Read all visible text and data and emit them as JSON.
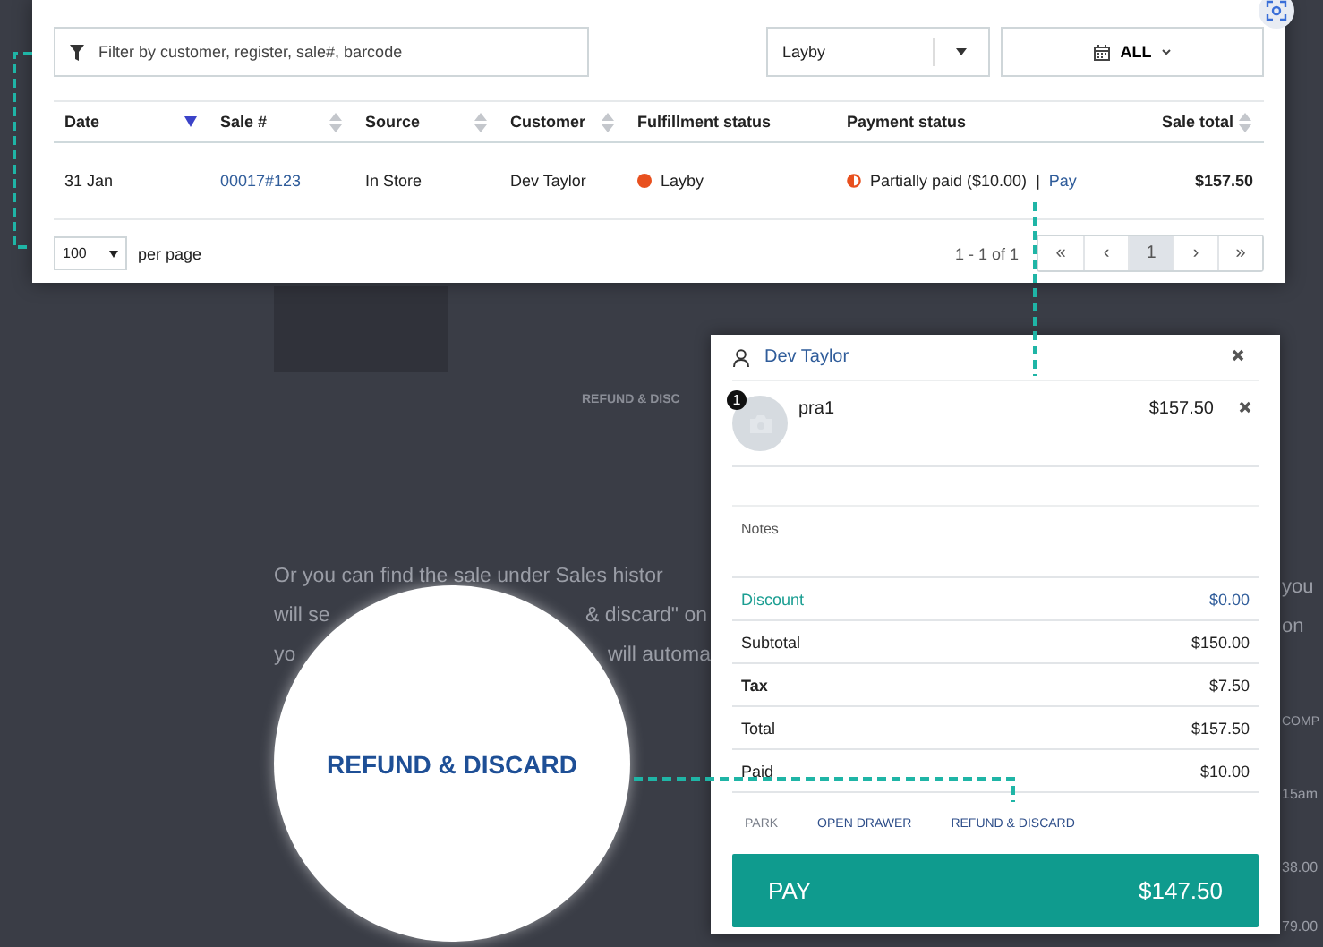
{
  "article": {
    "faded_button": "REFUND & DISC",
    "lines": [
      [
        "Or you can find the sale under Sales histor"
      ],
      [
        "will se",
        "& discard\" on"
      ],
      [
        "yo",
        "will automa"
      ]
    ],
    "edge_texts": [
      "you",
      "on",
      "COMP",
      "15am",
      "38.00",
      "79.00"
    ]
  },
  "filter": {
    "placeholder": "Filter by customer, register, sale#, barcode"
  },
  "status_select": {
    "value": "Layby"
  },
  "date_filter": {
    "label": "ALL"
  },
  "table": {
    "columns": [
      {
        "label": "Date",
        "sorted": true
      },
      {
        "label": "Sale #",
        "sorted": false
      },
      {
        "label": "Source",
        "sorted": false
      },
      {
        "label": "Customer",
        "sorted": false
      },
      {
        "label": "Fulfillment status"
      },
      {
        "label": "Payment status"
      },
      {
        "label": "Sale total",
        "sorted": false
      }
    ],
    "rows": [
      {
        "date": "31 Jan",
        "sale": "00017#123",
        "source": "In Store",
        "customer": "Dev Taylor",
        "fulfillment": {
          "label": "Layby",
          "color": "#e8501e"
        },
        "payment": {
          "label": "Partially paid ($10.00)",
          "separator": "|",
          "link": "Pay"
        },
        "total": "$157.50"
      }
    ]
  },
  "pagination": {
    "page_size": "100",
    "per_page_label": "per page",
    "range": "1 - 1 of 1",
    "buttons": [
      {
        "label": "«",
        "selected": false
      },
      {
        "label": "‹",
        "selected": false
      },
      {
        "label": "1",
        "selected": true
      },
      {
        "label": "›",
        "selected": false
      },
      {
        "label": "»",
        "selected": false
      }
    ]
  },
  "cart": {
    "customer": "Dev Taylor",
    "items": [
      {
        "qty": "1",
        "name": "pra1",
        "price": "$157.50"
      }
    ],
    "notes_label": "Notes",
    "totals": [
      {
        "label": "Discount",
        "value": "$0.00",
        "kind": "link"
      },
      {
        "label": "Subtotal",
        "value": "$150.00",
        "kind": "plain"
      },
      {
        "label": "Tax",
        "value": "$7.50",
        "kind": "bold"
      },
      {
        "label": "Total",
        "value": "$157.50",
        "kind": "plain"
      },
      {
        "label": "Paid",
        "value": "$10.00",
        "kind": "plain"
      }
    ],
    "actions": [
      {
        "label": "PARK",
        "disabled": true
      },
      {
        "label": "OPEN DRAWER",
        "disabled": false
      },
      {
        "label": "REFUND & DISCARD",
        "disabled": false
      }
    ],
    "pay": {
      "label": "PAY",
      "amount": "$147.50"
    }
  },
  "callout": {
    "label": "REFUND & DISCARD"
  }
}
